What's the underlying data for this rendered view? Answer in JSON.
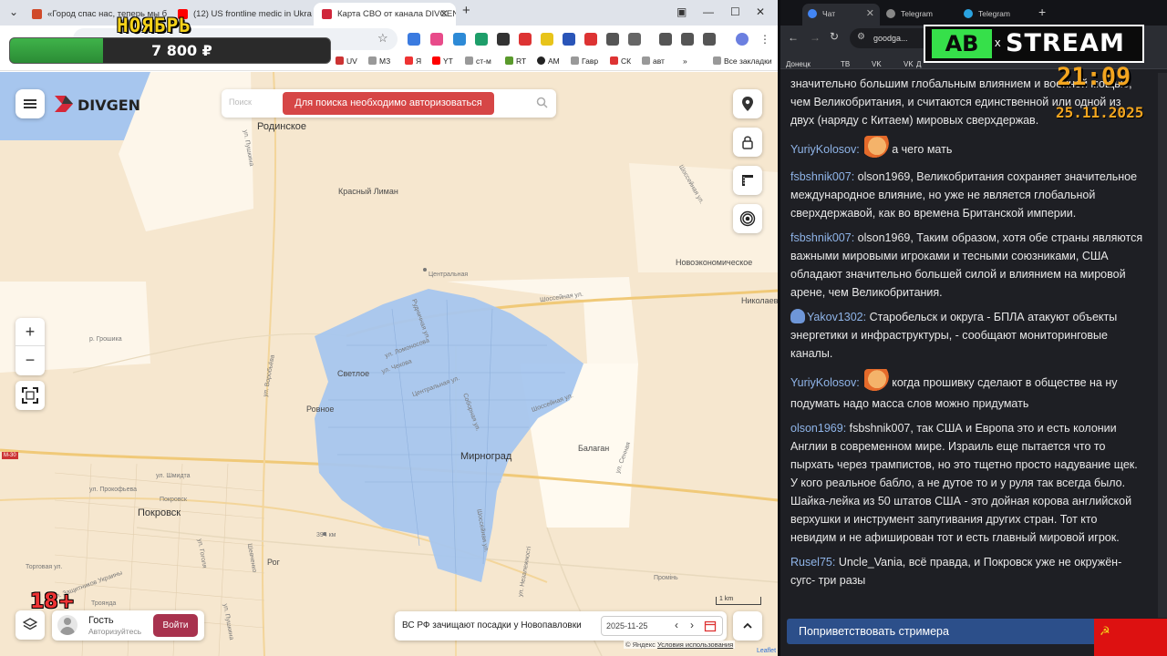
{
  "left": {
    "tabs": [
      {
        "title": "«Город спас нас, теперь мы б",
        "color": "#d04a2a"
      },
      {
        "title": "(12) US frontline medic in Ukra",
        "color": "#ff0000"
      },
      {
        "title": "Карта СВО от канала DIVGEN",
        "color": "#d0263a"
      }
    ],
    "bookmarks": [
      "UV",
      "МЗ",
      "Я",
      "YT",
      "ст-м",
      "RT",
      "AM",
      "Гавр",
      "СК",
      "авт",
      "Все закладки"
    ],
    "overlay": {
      "month": "НОЯБРЬ",
      "goal_amount": "7 800 ₽",
      "goal_progress": 0.29
    },
    "map": {
      "logo": "DIVGEN",
      "search_placeholder": "Поиск",
      "auth_message": "Для поиска необходимо авторизоваться",
      "labels": {
        "rodinskoe": "Родинское",
        "krasny_liman": "Красный Лиман",
        "tsentralnaya": "Центральная",
        "novoekonomicheskoe": "Новоэкономическое",
        "nikolaev": "Николаев",
        "shosseinaya1": "Шоссейная ул.",
        "shosseinaya2": "Шоссейная ул.",
        "shosseinaya3": "Шоссейная ул.",
        "svetloe": "Светлое",
        "rovnoe": "Ровное",
        "mirnograd": "Мирноград",
        "balagan": "Балаган",
        "pokrovsk": "Покровск",
        "pokrovsk_small": "Покровск",
        "rog": "Рог",
        "promin": "Промінь",
        "troyanda": "Троянда",
        "dist394": "394 км",
        "m30": "M-30",
        "groshika": "р. Грошика",
        "ul_shmidta": "ул. Шмидта",
        "ul_prokofyeva": "ул. Прокофьева",
        "ul_pushkina": "ул. Пушкина",
        "ul_vorobyova": "ул. Воробьёва",
        "ul_lomonosova": "ул. Ломоносова",
        "ul_chekhova": "ул. Чехова",
        "ul_rudnichnaya": "Рудничная ул.",
        "ul_tsentralnaya": "Центральная ул.",
        "ul_sobornaya": "Соборная ул.",
        "ul_zashchitnikov": "ул. Защитников Украины",
        "ul_torgovaya": "Торговая ул.",
        "ul_gogolya": "ул. Гоголя",
        "ul_pushkina2": "ул. Пушкина",
        "ul_shevchenko": "Шевченко",
        "ul_shosseinaya4": "Шоссейная ул.",
        "ul_sennaya": "ул. Сенная",
        "ul_nezalezhnosti": "ул. Незалежності"
      },
      "user_name": "Гость",
      "user_sub": "Авторизуйтесь",
      "login_label": "Войти",
      "age_badge": "18+",
      "news": "ВС РФ зачищают посадки у Новопавловки",
      "date": "2025-11-25",
      "scale": "1 km",
      "attribution": "© Яндекс",
      "attribution_link": "Условия использования",
      "leaflet": "Leaflet"
    },
    "colors": {
      "occupied": "#a7c6ee",
      "map_bg": "#f6e7cf",
      "auth_red": "#d64646",
      "login": "#a8324e"
    }
  },
  "right": {
    "tabs": [
      {
        "title": "Чат",
        "color": "#4285f4"
      },
      {
        "title": "Telegram",
        "color": "#888888"
      },
      {
        "title": "Telegram",
        "color": "#2aa3e0"
      }
    ],
    "address": "goodga...",
    "bookmarks": [
      "Донецк",
      "ТВ",
      "VK",
      "VK",
      "Д"
    ],
    "brand": {
      "ab": "АВ",
      "x": "x",
      "stream": "STREAM"
    },
    "clock": "21:09",
    "date": "25.11.2025",
    "messages": [
      {
        "nick": "",
        "text": "значительно большим глобальным влиянием и военной мощью, чем Великобритания, и считаются единственной или одной из двух (наряду с Китаем) мировых сверхдержав.",
        "emote": false,
        "badge": false
      },
      {
        "nick": "YuriyKolosov:",
        "text": "а чего мать",
        "emote": true,
        "badge": false
      },
      {
        "nick": "fsbshnik007:",
        "text": "olson1969, Великобритания сохраняет значительное международное влияние, но уже не является глобальной сверхдержавой, как во времена Британской империи.",
        "emote": false,
        "badge": false
      },
      {
        "nick": "fsbshnik007:",
        "text": "olson1969, Таким образом, хотя обе страны являются важными мировыми игроками и тесными союзниками, США обладают значительно большей силой и влиянием на мировой арене, чем Великобритания.",
        "emote": false,
        "badge": false
      },
      {
        "nick": "Yakov1302:",
        "text": "Старобельск и округа - БПЛА атакуют объекты энергетики и инфраструктуры, - сообщают мониторинговые каналы.",
        "emote": false,
        "badge": true
      },
      {
        "nick": "YuriyKolosov:",
        "text": "когда прошивку сделают в обществе на ну подумать надо масса слов можно придумать",
        "emote": true,
        "badge": false
      },
      {
        "nick": "olson1969:",
        "text": "fsbshnik007, так США и Европа это и есть колонии Англии в современном мире. Израиль еще пытается что то пырхать через трампистов, но это тщетно просто надувание щек. У кого реальное бабло, а не дутое то и у руля так всегда было. Шайка-лейка из 50 штатов США - это дойная корова английской верхушки и инструмент запугивания других стран. Тот кто невидим и не афиширован тот и есть главный мировой игрок.",
        "emote": false,
        "badge": false
      },
      {
        "nick": "Rusel75:",
        "text": "Uncle_Vania, всё правда, и Покровск уже не окружён- сугс- три разы",
        "emote": false,
        "badge": false
      }
    ],
    "greet": "Поприветствовать стримера",
    "flag_symbol": "☭"
  }
}
